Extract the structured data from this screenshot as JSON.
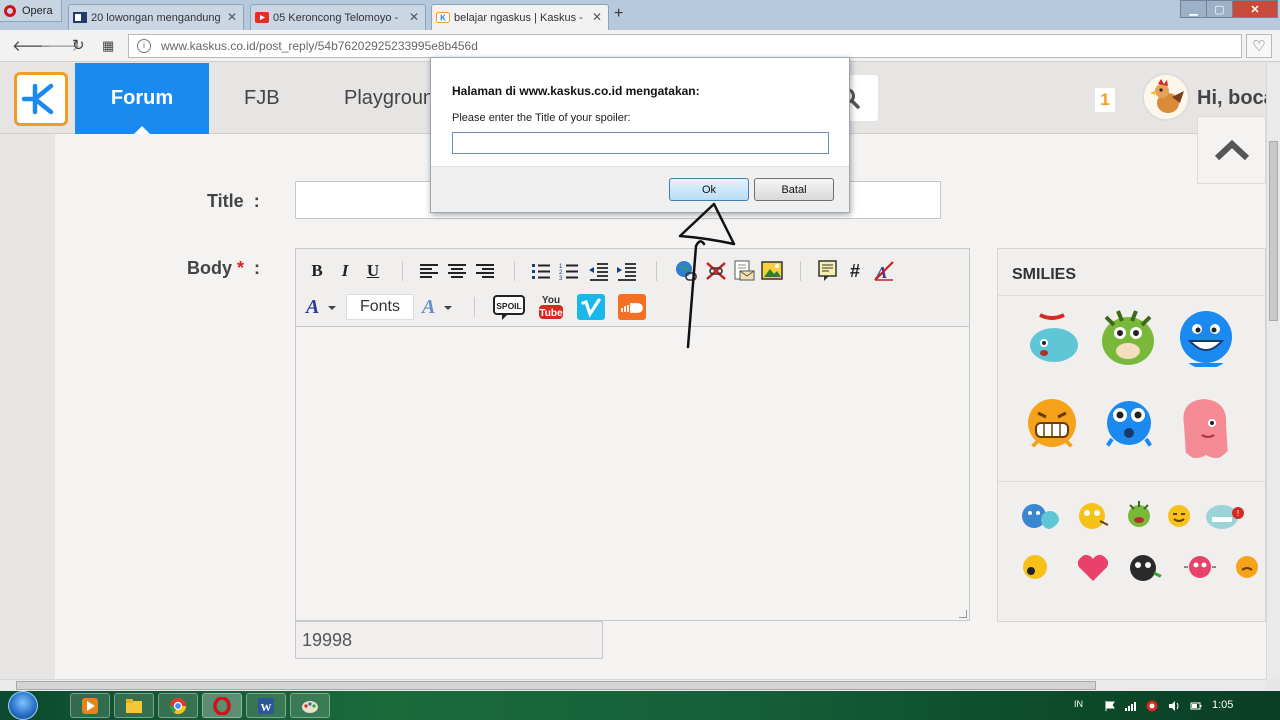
{
  "browser": {
    "menu_label": "Opera",
    "tabs": [
      {
        "label": "20 lowongan mengandung",
        "favicon_color": "#1f3a6b"
      },
      {
        "label": "05 Keroncong Telomoyo -",
        "favicon_color": "#e52d27"
      },
      {
        "label": "belajar ngaskus | Kaskus -",
        "favicon_color": "#f59a23",
        "active": true
      }
    ],
    "url": "www.kaskus.co.id/post_reply/54b76202925233995e8b456d"
  },
  "site": {
    "nav": {
      "forum": "Forum",
      "fjb": "FJB",
      "playground": "Playground"
    },
    "notification_count": "1",
    "greeting": "Hi, bocah",
    "accent_color": "#1b8af0"
  },
  "form": {
    "title_label": "Title",
    "title_colon": ":",
    "body_label": "Body",
    "required_mark": "*",
    "body_colon": ":",
    "fonts_button": "Fonts",
    "char_counter": "19998",
    "smilies_title": "SMILIES"
  },
  "dialog": {
    "heading": "Halaman di www.kaskus.co.id mengatakan:",
    "message": "Please enter the Title of your spoiler:",
    "input_value": "",
    "ok_label": "Ok",
    "cancel_label": "Batal"
  },
  "taskbar": {
    "language": "IN",
    "clock": "1:05"
  }
}
